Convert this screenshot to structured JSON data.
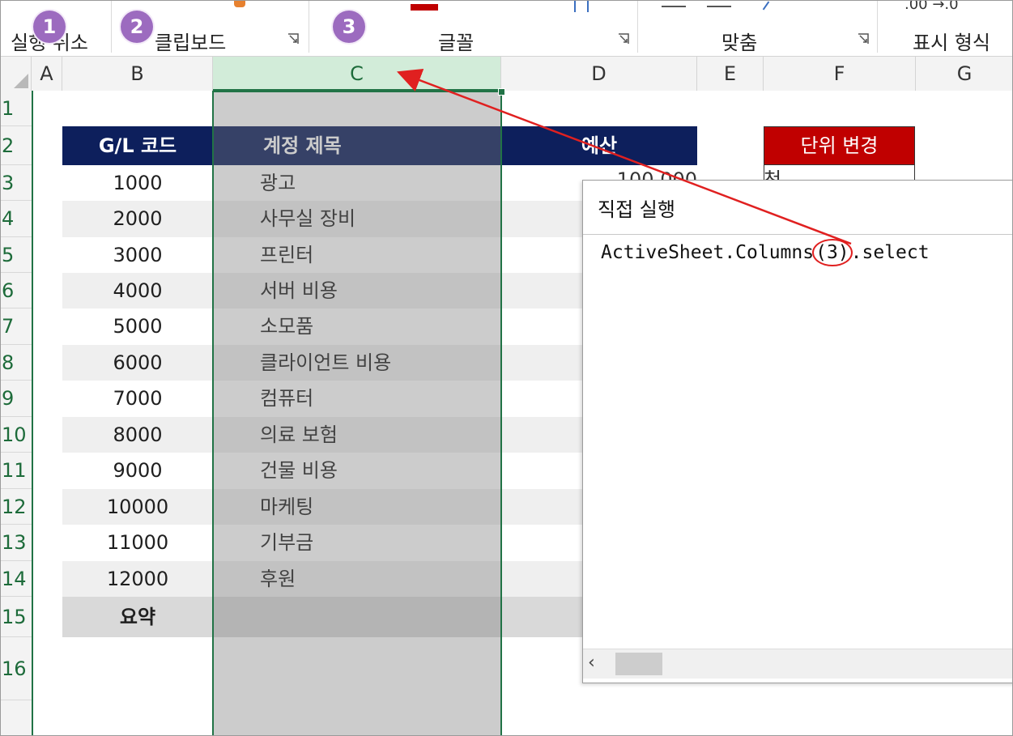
{
  "ribbon": {
    "groups": [
      {
        "label": "실행 취소"
      },
      {
        "label": "클립보드"
      },
      {
        "label": "글꼴"
      },
      {
        "label": "맞춤"
      },
      {
        "label": "표시 형식"
      }
    ],
    "number_format_snippet": ".00  →.0"
  },
  "badges": [
    "1",
    "2",
    "3"
  ],
  "columns": [
    "A",
    "B",
    "C",
    "D",
    "E",
    "F",
    "G"
  ],
  "rows": [
    "1",
    "2",
    "3",
    "4",
    "5",
    "6",
    "7",
    "8",
    "9",
    "10",
    "11",
    "12",
    "13",
    "14",
    "15",
    "16"
  ],
  "table": {
    "headers": {
      "code": "G/L 코드",
      "title": "계정 제목",
      "budget": "예산"
    },
    "rows": [
      {
        "code": "1000",
        "title": "광고"
      },
      {
        "code": "2000",
        "title": "사무실 장비"
      },
      {
        "code": "3000",
        "title": "프린터"
      },
      {
        "code": "4000",
        "title": "서버 비용"
      },
      {
        "code": "5000",
        "title": "소모품"
      },
      {
        "code": "6000",
        "title": "클라이언트 비용"
      },
      {
        "code": "7000",
        "title": "컴퓨터"
      },
      {
        "code": "8000",
        "title": "의료 보험"
      },
      {
        "code": "9000",
        "title": "건물 비용"
      },
      {
        "code": "10000",
        "title": "마케팅"
      },
      {
        "code": "11000",
        "title": "기부금"
      },
      {
        "code": "12000",
        "title": "후원"
      }
    ],
    "summary_label": "요약",
    "partial_budget_value": "100,000"
  },
  "unit_button": {
    "label": "단위 변경",
    "below_partial": "천"
  },
  "immediate_window": {
    "title": "직접 실행",
    "code_prefix": "ActiveSheet.Columns",
    "code_arg": "(3)",
    "code_suffix": ".select"
  },
  "colors": {
    "header_navy": "#0d1f5c",
    "unit_red": "#c00000",
    "selection_green": "#217346",
    "badge_purple": "#9c6bbf",
    "annotation_red": "#e02020"
  }
}
